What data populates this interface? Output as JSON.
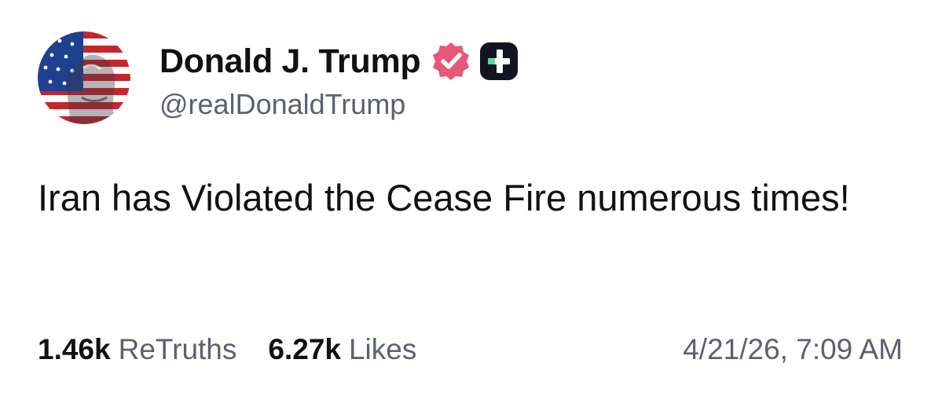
{
  "author": {
    "display_name": "Donald J. Trump",
    "handle": "@realDonaldTrump",
    "avatar_icon": "flag-portrait-avatar",
    "verified_icon": "verified-badge-icon",
    "verified_color": "#e8577a",
    "plus_icon": "truth-plus-icon"
  },
  "post": {
    "body": "Iran has Violated the Cease Fire numerous times!"
  },
  "stats": {
    "retruths_count": "1.46k",
    "retruths_label": "ReTruths",
    "likes_count": "6.27k",
    "likes_label": "Likes",
    "timestamp": "4/21/26, 7:09 AM"
  },
  "colors": {
    "text": "#111111",
    "muted": "#5c6170",
    "badge_dark": "#121521",
    "badge_accent": "#5fd4a8"
  }
}
